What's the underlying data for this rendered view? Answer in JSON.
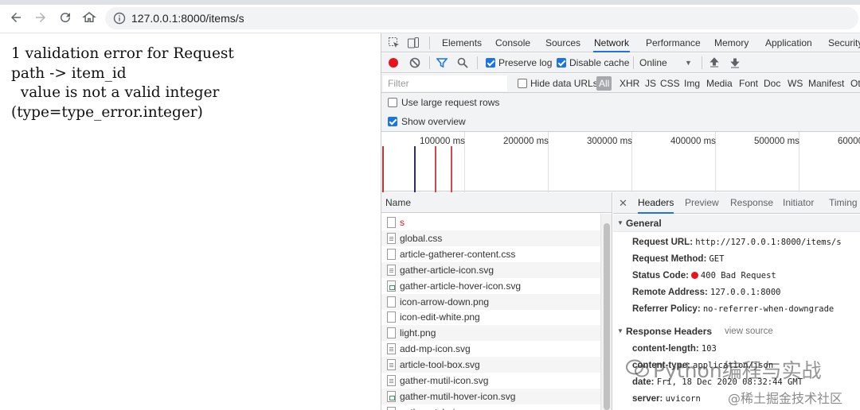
{
  "browser": {
    "url": "127.0.0.1:8000/items/s"
  },
  "page": {
    "error_lines": [
      "1 validation error for Request",
      "path -> item_id",
      "  value is not a valid integer",
      "(type=type_error.integer)"
    ]
  },
  "devtools": {
    "tabs": [
      "Elements",
      "Console",
      "Sources",
      "Network",
      "Performance",
      "Memory",
      "Application",
      "Security"
    ],
    "active_tab": "Network",
    "toolbar": {
      "preserve_log": "Preserve log",
      "disable_cache": "Disable cache",
      "throttle": "Online"
    },
    "filter": {
      "placeholder": "Filter",
      "hide_data_urls": "Hide data URLs",
      "types": [
        "All",
        "XHR",
        "JS",
        "CSS",
        "Img",
        "Media",
        "Font",
        "Doc",
        "WS",
        "Manifest",
        "Ot"
      ]
    },
    "options": {
      "large_rows": "Use large request rows",
      "show_overview": "Show overview"
    },
    "overview_ticks": [
      "100000 ms",
      "200000 ms",
      "300000 ms",
      "400000 ms",
      "500000 ms",
      "60000"
    ],
    "name_header": "Name",
    "files": [
      {
        "name": "s",
        "type": "doc",
        "error": true
      },
      {
        "name": "global.css",
        "type": "css"
      },
      {
        "name": "article-gatherer-content.css",
        "type": "doc"
      },
      {
        "name": "gather-article-icon.svg",
        "type": "css"
      },
      {
        "name": "gather-article-hover-icon.svg",
        "type": "svg"
      },
      {
        "name": "icon-arrow-down.png",
        "type": "doc"
      },
      {
        "name": "icon-edit-white.png",
        "type": "doc"
      },
      {
        "name": "light.png",
        "type": "doc"
      },
      {
        "name": "add-mp-icon.svg",
        "type": "css"
      },
      {
        "name": "article-tool-box.svg",
        "type": "css"
      },
      {
        "name": "gather-mutil-icon.svg",
        "type": "css"
      },
      {
        "name": "gather-mutil-hover-icon.svg",
        "type": "svg"
      },
      {
        "name": "gather-style-icon.svg",
        "type": "css"
      }
    ],
    "detail_tabs": [
      "Headers",
      "Preview",
      "Response",
      "Initiator",
      "Timing"
    ],
    "active_detail_tab": "Headers",
    "general": {
      "title": "General",
      "request_url_key": "Request URL:",
      "request_url": "http://127.0.0.1:8000/items/s",
      "method_key": "Request Method:",
      "method": "GET",
      "status_key": "Status Code:",
      "status": "400 Bad Request",
      "remote_key": "Remote Address:",
      "remote": "127.0.0.1:8000",
      "referrer_key": "Referrer Policy:",
      "referrer": "no-referrer-when-downgrade"
    },
    "response_headers": {
      "title": "Response Headers",
      "view_source": "view source",
      "content_length_key": "content-length:",
      "content_length": "103",
      "content_type_key": "content-type:",
      "content_type": "application/json",
      "date_key": "date:",
      "date": "Fri, 18 Dec 2020 08:32:44 GMT",
      "server_key": "server:",
      "server": "uvicorn"
    }
  },
  "watermark": {
    "line1": "Python编程与实战",
    "line2": "@稀土掘金技术社区"
  },
  "colors": {
    "accent": "#1a73e8",
    "error": "#e8141d"
  }
}
